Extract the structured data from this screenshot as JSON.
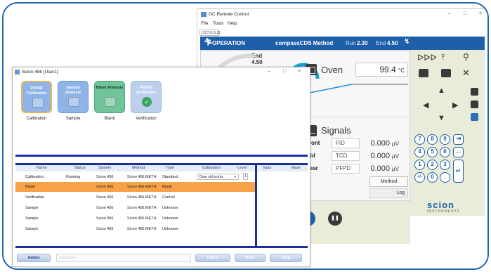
{
  "gc_window": {
    "title": "GC Remote Control",
    "menu": [
      "File",
      "Tools",
      "Help"
    ],
    "address": "[127.0.0.1]",
    "status": "OPERATION",
    "method_name": "compassCDS Method",
    "run_label": "Run",
    "run_value": "2.30",
    "end_label": "End",
    "end_value": "4.50",
    "end_gauge": {
      "label": "End",
      "value": "4.50"
    },
    "oven": {
      "label": "Oven",
      "value": "99.4",
      "unit": "°C"
    },
    "signals_label": "Signals",
    "signals": [
      {
        "name": "Front",
        "detector": "FID",
        "value": "0.000",
        "unit": "µV"
      },
      {
        "name": "Mid",
        "detector": "TCD",
        "value": "0.000",
        "unit": "µV"
      },
      {
        "name": "Rear",
        "detector": "PFPD",
        "value": "0.000",
        "unit": "µV"
      }
    ],
    "method_button": "Method",
    "log_button": "Log",
    "keypad": [
      "7",
      "8",
      "9",
      "4",
      "5",
      "6",
      "1",
      "2",
      "3",
      "+/-",
      "0",
      "."
    ],
    "logo": {
      "brand": "scion",
      "sub": "INSTRUMENTS"
    }
  },
  "scion_window": {
    "title": "Scion 456 [User1]",
    "tiles": [
      {
        "title": "PDHID Calibration",
        "caption": "Calibration",
        "color": "#8fb4e8"
      },
      {
        "title": "Sample Analysis",
        "caption": "Sample",
        "color": "#8fb4e8"
      },
      {
        "title": "Blank Analysis",
        "caption": "Blank",
        "color": "#6fc49a"
      },
      {
        "title": "PDHID Verification",
        "caption": "Verification",
        "color": "#bcd0ee"
      }
    ],
    "columns": [
      "Name",
      "Status",
      "System",
      "Method",
      "Type",
      "Calibration",
      "Level"
    ],
    "columns_right": [
      "Input",
      "Value"
    ],
    "rows": [
      {
        "name": "Calibration",
        "status": "Running",
        "system": "Scion 456",
        "method": "Scion 456.METH",
        "type": "Standard",
        "calibration": "Clear old points",
        "level": "1"
      },
      {
        "name": "Blank",
        "status": "",
        "system": "Scion 456",
        "method": "Scion 456.METH",
        "type": "Blank",
        "calibration": "",
        "level": ""
      },
      {
        "name": "Verification",
        "status": "",
        "system": "Scion 456",
        "method": "Scion 456.METH",
        "type": "Control",
        "calibration": "",
        "level": ""
      },
      {
        "name": "Sample",
        "status": "",
        "system": "Scion 456",
        "method": "Scion 456.METH",
        "type": "Unknown",
        "calibration": "",
        "level": ""
      },
      {
        "name": "Sample",
        "status": "",
        "system": "Scion 456",
        "method": "Scion 456.METH",
        "type": "Unknown",
        "calibration": "",
        "level": ""
      },
      {
        "name": "Sample",
        "status": "",
        "system": "Scion 456",
        "method": "Scion 456.METH",
        "type": "Unknown",
        "calibration": "",
        "level": ""
      }
    ],
    "footer": {
      "admin": "Admin",
      "input_value": "Inquisitive",
      "delete": "Delete",
      "start": "Start",
      "stop": "Stop"
    }
  },
  "colors": {
    "frame": "#1f66b3",
    "gc_header": "#1d5fa8",
    "schedule_border": "#1a2f9c",
    "selected_row": "#f7a247",
    "panel_bg": "#e9ecd8"
  }
}
